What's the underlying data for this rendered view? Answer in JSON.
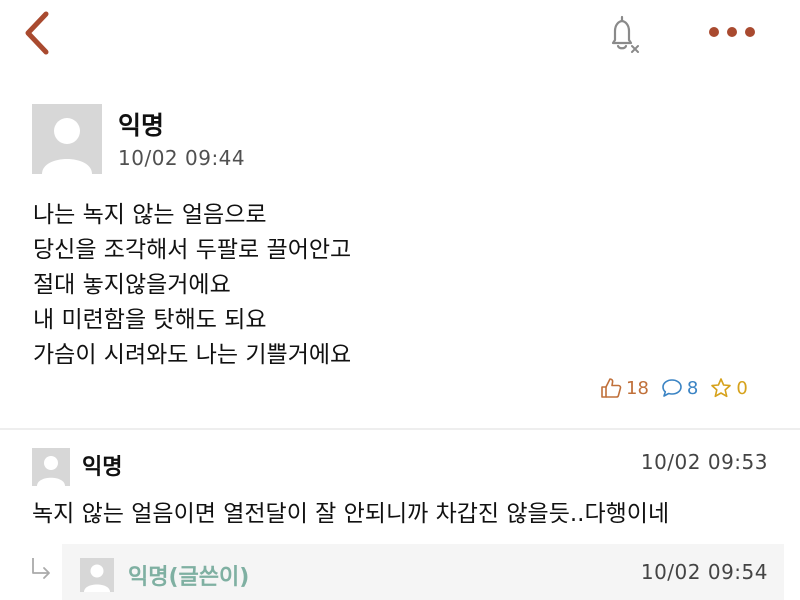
{
  "colors": {
    "accent": "#a94a2f",
    "like": "#c0703a",
    "comment": "#3b84c4",
    "scrap": "#d6a21c",
    "writer_tag": "#7fb0a2"
  },
  "header": {
    "back_icon": "chevron-left-icon",
    "bell_icon": "bell-off-icon",
    "more_icon": "more-dots-icon"
  },
  "post": {
    "author": "익명",
    "timestamp": "10/02 09:44",
    "lines": [
      "나는 녹지 않는 얼음으로",
      "당신을 조각해서 두팔로 끌어안고",
      "절대 놓지않을거에요",
      "내 미련함을 탓해도 되요",
      "가슴이 시려와도 나는 기쁠거에요"
    ],
    "likes": "18",
    "comments": "8",
    "scraps": "0"
  },
  "comment": {
    "author": "익명",
    "timestamp": "10/02 09:53",
    "text": "녹지 않는 얼음이면 열전달이 잘 안되니까 차갑진 않을듯..다행이네"
  },
  "reply": {
    "author": "익명(글쓴이)",
    "timestamp": "10/02 09:54"
  }
}
